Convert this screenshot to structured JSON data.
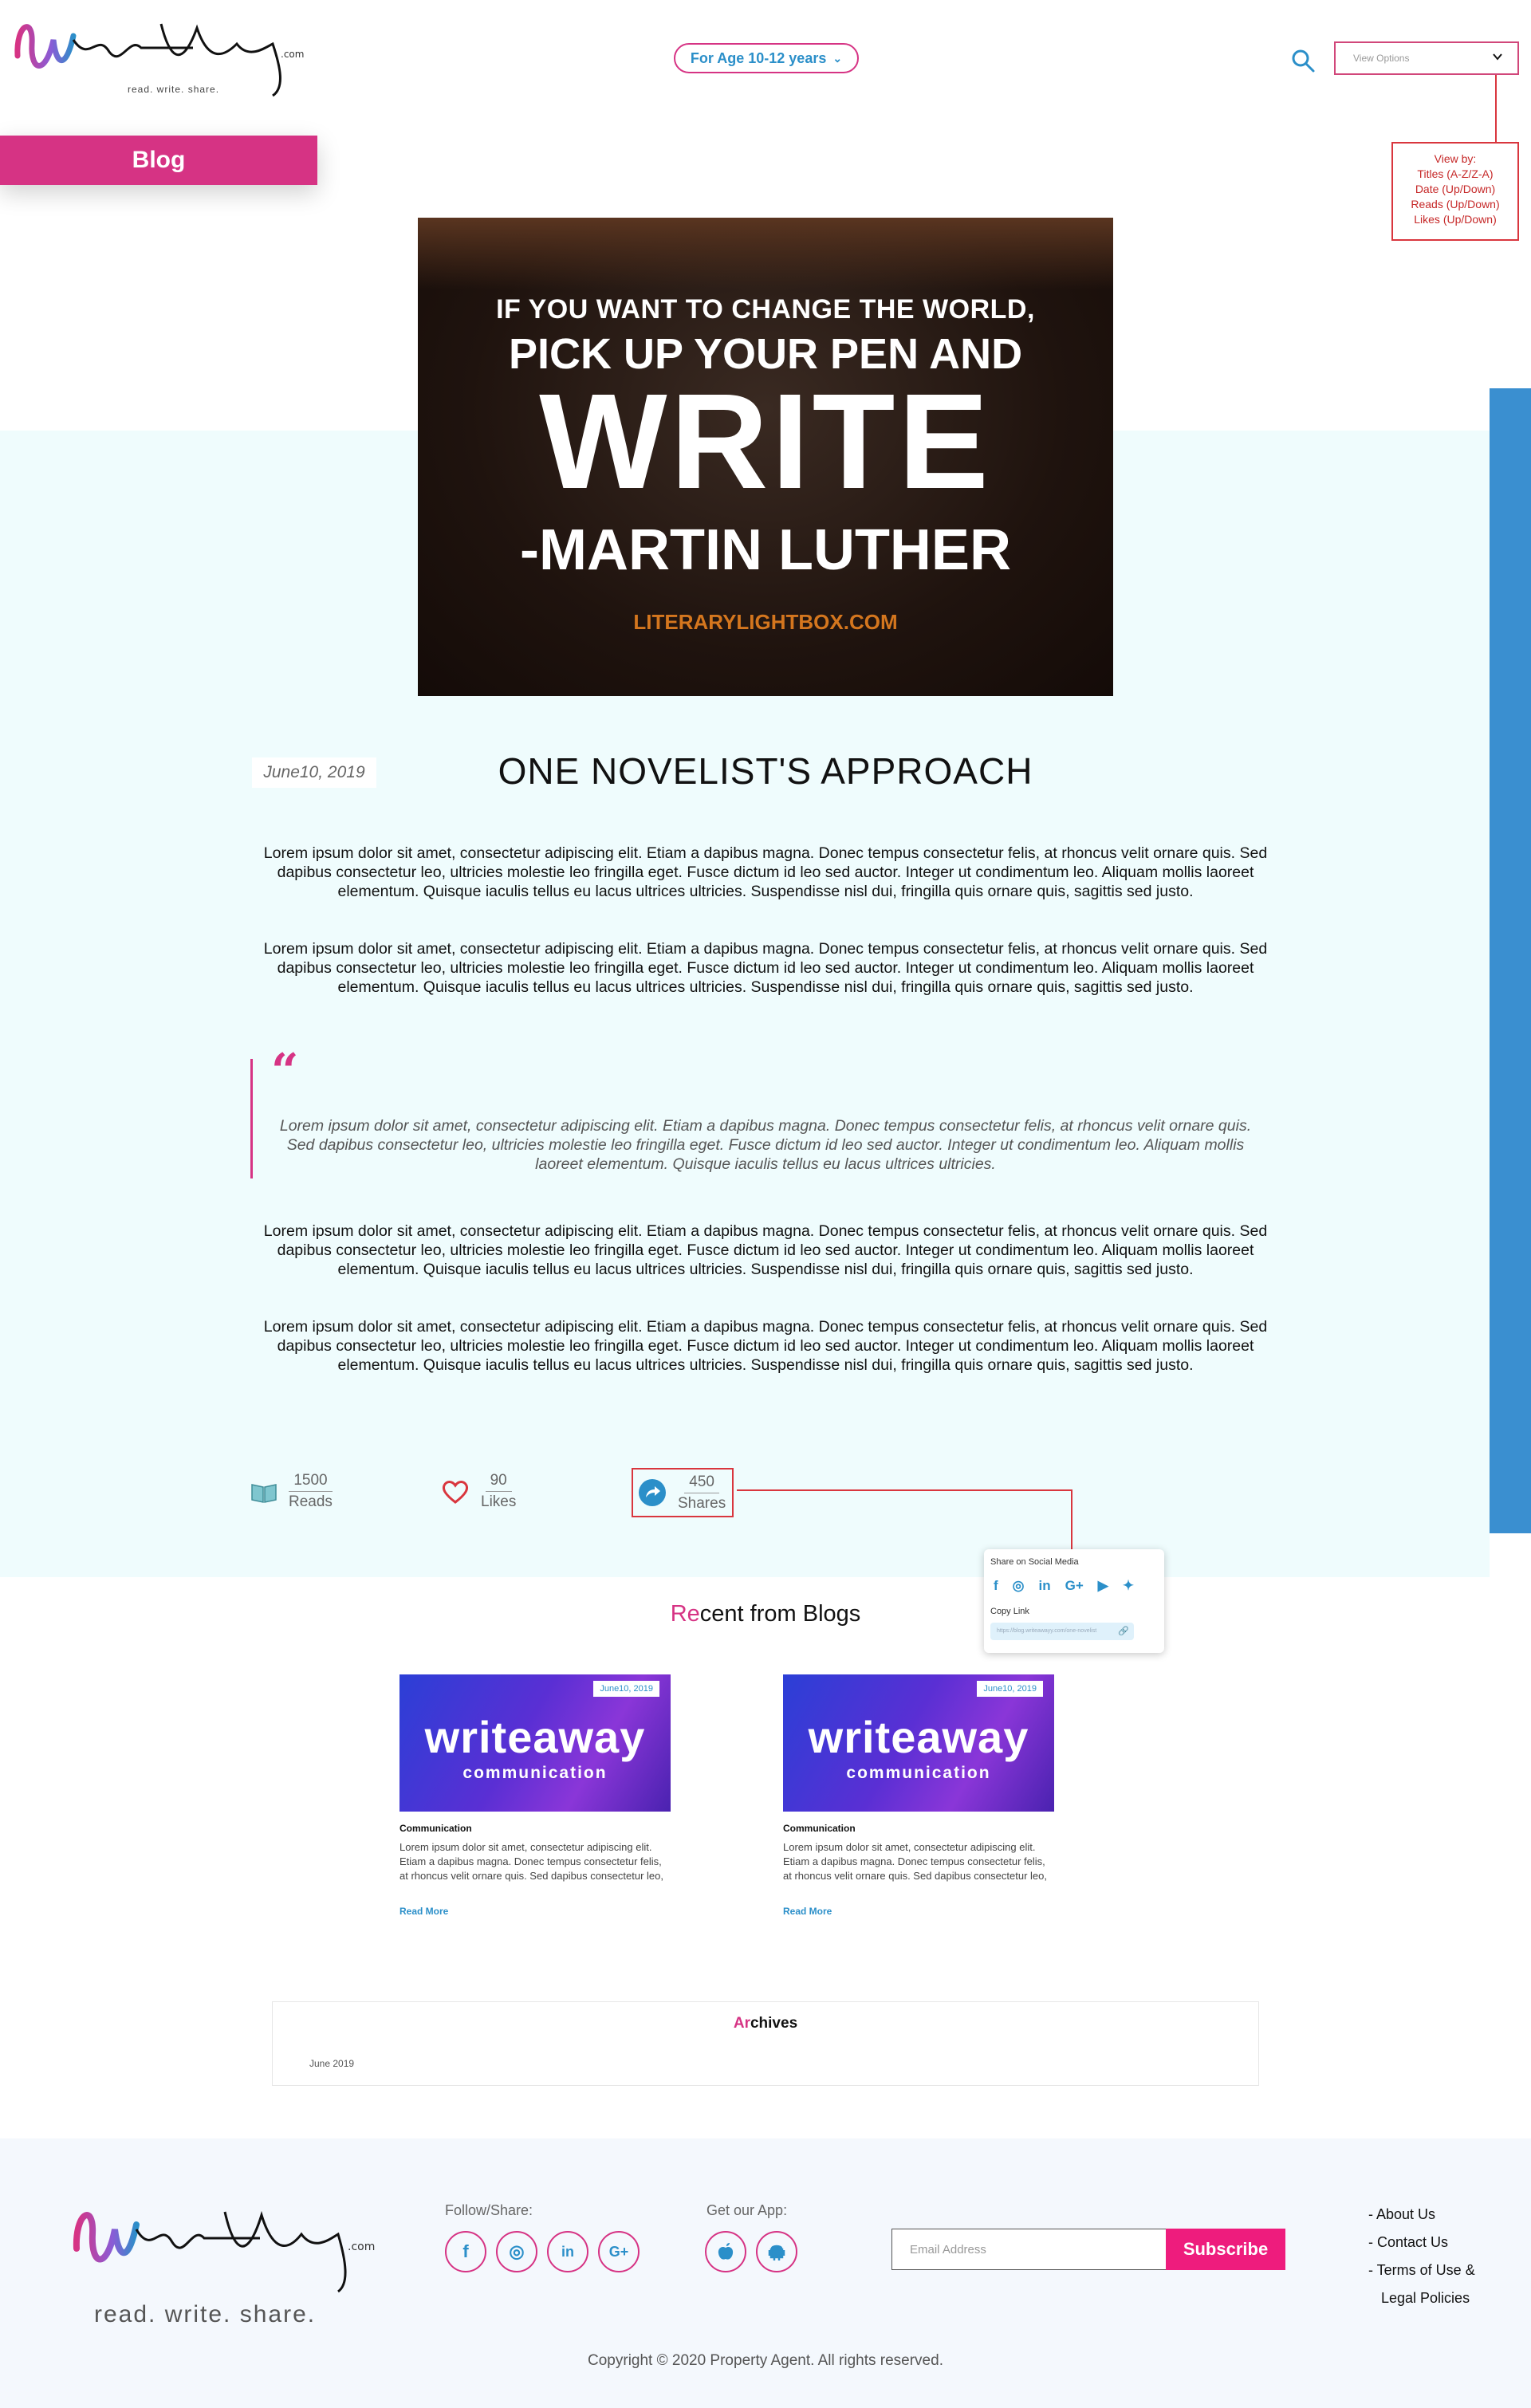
{
  "brand": {
    "logo_text": "WriteAwayy.com",
    "tagline": "read. write. share.",
    "accent": "#d63384",
    "blue": "#2b8fc9"
  },
  "header": {
    "age_filter": "For Age 10-12 years",
    "view_options_placeholder": "View Options",
    "view_note_title": "View by:",
    "view_note_items": [
      "Titles (A-Z/Z-A)",
      "Date (Up/Down)",
      "Reads (Up/Down)",
      "Likes (Up/Down)"
    ]
  },
  "section_tab": "Blog",
  "hero": {
    "line1": "IF YOU WANT TO CHANGE THE WORLD,",
    "line2": "PICK UP YOUR PEN AND",
    "line3": "WRITE",
    "line4": "-MARTIN LUTHER",
    "line5": "LITERARYLIGHTBOX.COM"
  },
  "post": {
    "date": "June10, 2019",
    "title": "ONE NOVELIST'S APPROACH",
    "paragraph": "Lorem ipsum dolor sit amet, consectetur adipiscing elit. Etiam a dapibus magna. Donec tempus consectetur felis, at rhoncus velit ornare quis. Sed dapibus consectetur leo, ultricies molestie leo fringilla eget. Fusce dictum id leo sed auctor. Integer ut condimentum leo. Aliquam mollis laoreet elementum. Quisque iaculis tellus eu lacus ultrices ultricies. Suspendisse nisl dui, fringilla quis ornare quis, sagittis sed justo.",
    "quote": "Lorem ipsum dolor sit amet, consectetur adipiscing elit. Etiam a dapibus magna. Donec tempus consectetur felis, at rhoncus velit ornare quis. Sed dapibus consectetur leo, ultricies molestie leo fringilla eget. Fusce dictum id leo sed auctor. Integer ut condimentum leo. Aliquam mollis laoreet elementum. Quisque iaculis tellus eu lacus ultrices ultricies.",
    "quote_mark": "“"
  },
  "stats": {
    "reads_count": "1500",
    "reads_label": "Reads",
    "likes_count": "90",
    "likes_label": "Likes",
    "shares_count": "450",
    "shares_label": "Shares"
  },
  "share_popup": {
    "title": "Share on Social Media",
    "icons": [
      "facebook-icon",
      "instagram-icon",
      "linkedin-icon",
      "google-plus-icon",
      "youtube-icon",
      "twitter-icon"
    ],
    "copy_label": "Copy Link",
    "link_value": "https://blog.writeawayy.com/one-novelist"
  },
  "recent": {
    "title_hl": "Re",
    "title_rest": "cent from Blogs",
    "cards": [
      {
        "date": "June10, 2019",
        "img_title": "writeaway",
        "img_sub": "communication",
        "category": "Communication",
        "excerpt": "Lorem ipsum dolor sit amet, consectetur adipiscing elit. Etiam a dapibus magna. Donec tempus consectetur felis, at rhoncus velit ornare quis. Sed dapibus consectetur leo,",
        "more": "Read More"
      },
      {
        "date": "June10, 2019",
        "img_title": "writeaway",
        "img_sub": "communication",
        "category": "Communication",
        "excerpt": "Lorem ipsum dolor sit amet, consectetur adipiscing elit. Etiam a dapibus magna. Donec tempus consectetur felis, at rhoncus velit ornare quis. Sed dapibus consectetur leo,",
        "more": "Read More"
      }
    ]
  },
  "archives": {
    "title_hl": "Ar",
    "title_rest": "chives",
    "items": [
      "June 2019"
    ]
  },
  "footer": {
    "follow_title": "Follow/Share:",
    "follow_icons": [
      "facebook-icon",
      "instagram-icon",
      "linkedin-icon",
      "google-plus-icon"
    ],
    "app_title": "Get our App:",
    "app_icons": [
      "apple-icon",
      "android-icon"
    ],
    "email_placeholder": "Email Address",
    "subscribe_label": "Subscribe",
    "links": [
      "- About Us",
      "- Contact Us",
      "- Terms of Use &",
      "Legal Policies"
    ],
    "copyright": "Copyright © 2020 Property Agent. All rights reserved."
  }
}
